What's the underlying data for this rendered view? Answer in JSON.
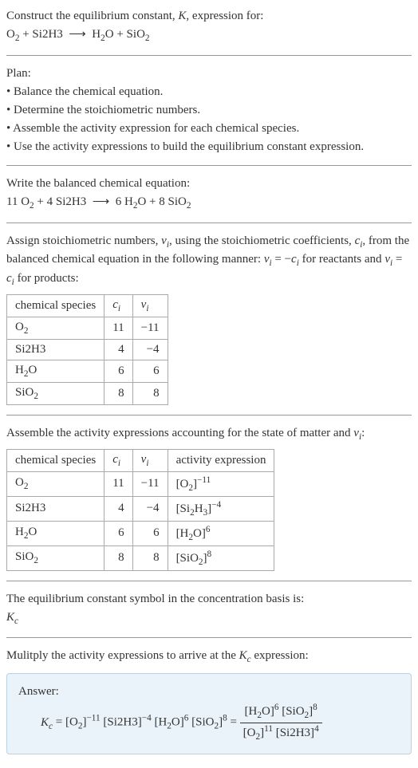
{
  "intro": {
    "line1": "Construct the equilibrium constant, K, expression for:",
    "equation": "O₂ + Si2H3 ⟶ H₂O + SiO₂"
  },
  "plan": {
    "heading": "Plan:",
    "items": [
      "• Balance the chemical equation.",
      "• Determine the stoichiometric numbers.",
      "• Assemble the activity expression for each chemical species.",
      "• Use the activity expressions to build the equilibrium constant expression."
    ]
  },
  "balanced": {
    "heading": "Write the balanced chemical equation:",
    "equation": "11 O₂ + 4 Si2H3 ⟶ 6 H₂O + 8 SiO₂"
  },
  "stoich_text": {
    "line": "Assign stoichiometric numbers, νᵢ, using the stoichiometric coefficients, cᵢ, from the balanced chemical equation in the following manner: νᵢ = −cᵢ for reactants and νᵢ = cᵢ for products:"
  },
  "stoich_table": {
    "headers": [
      "chemical species",
      "cᵢ",
      "νᵢ"
    ],
    "rows": [
      [
        "O₂",
        "11",
        "−11"
      ],
      [
        "Si2H3",
        "4",
        "−4"
      ],
      [
        "H₂O",
        "6",
        "6"
      ],
      [
        "SiO₂",
        "8",
        "8"
      ]
    ]
  },
  "activity_text": {
    "line": "Assemble the activity expressions accounting for the state of matter and νᵢ:"
  },
  "activity_table": {
    "headers": [
      "chemical species",
      "cᵢ",
      "νᵢ",
      "activity expression"
    ],
    "rows": [
      {
        "sp": "O₂",
        "c": "11",
        "v": "−11",
        "expr": "[O₂]⁻¹¹"
      },
      {
        "sp": "Si2H3",
        "c": "4",
        "v": "−4",
        "expr": "[Si₂H₃]⁻⁴"
      },
      {
        "sp": "H₂O",
        "c": "6",
        "v": "6",
        "expr": "[H₂O]⁶"
      },
      {
        "sp": "SiO₂",
        "c": "8",
        "v": "8",
        "expr": "[SiO₂]⁸"
      }
    ]
  },
  "kc_symbol": {
    "line": "The equilibrium constant symbol in the concentration basis is:",
    "sym": "K_c"
  },
  "multiply": {
    "line": "Mulitply the activity expressions to arrive at the K_c expression:"
  },
  "answer": {
    "label": "Answer:",
    "lhs": "K_c = [O₂]⁻¹¹ [Si2H3]⁻⁴ [H₂O]⁶ [SiO₂]⁸ =",
    "frac_num": "[H₂O]⁶ [SiO₂]⁸",
    "frac_den": "[O₂]¹¹ [Si2H3]⁴"
  }
}
